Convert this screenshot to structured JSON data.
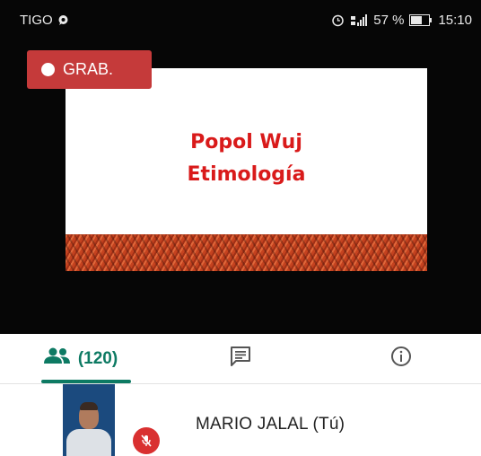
{
  "status_bar": {
    "carrier": "TIGO",
    "battery_percent": "57 %",
    "time": "15:10",
    "icons": [
      "whatsapp-icon",
      "alarm-icon",
      "signal-icon",
      "battery-icon"
    ]
  },
  "recording": {
    "label": "GRAB."
  },
  "slide": {
    "line1": "Popol Wuj",
    "line2": "Etimología"
  },
  "tabs": {
    "people_count": "(120)",
    "icons": [
      "people-icon",
      "chat-icon",
      "info-icon"
    ]
  },
  "participant": {
    "name": "MARIO JALAL (Tú)",
    "muted": true
  },
  "colors": {
    "accent": "#0d7a63",
    "record": "#c53a3a",
    "slide_title": "#d91a1a",
    "mute": "#d93030"
  }
}
